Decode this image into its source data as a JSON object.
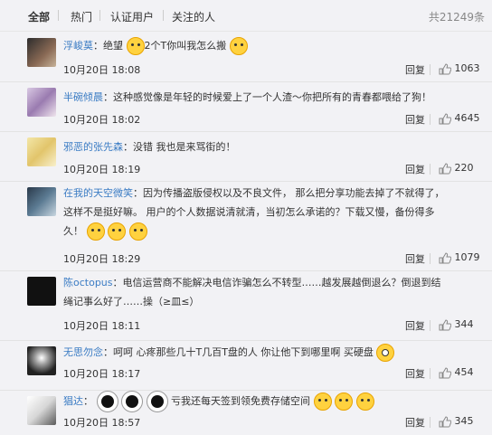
{
  "tabs": [
    {
      "label": "全部",
      "active": true
    },
    {
      "label": "热门",
      "active": false
    },
    {
      "label": "认证用户",
      "active": false
    },
    {
      "label": "关注的人",
      "active": false
    }
  ],
  "total_count": "共21249条",
  "reply_label": "回复",
  "comments": [
    {
      "user": "浮峻莫",
      "text_parts": [
        "绝望",
        "2个T你叫我怎么搬"
      ],
      "time": "10月20日 18:08",
      "likes": "1063"
    },
    {
      "user": "半碗倾晨",
      "text": "这种感觉像是年轻的时候爱上了一个人渣～你把所有的青春都喂给了狗！",
      "time": "10月20日 18:02",
      "likes": "4645"
    },
    {
      "user": "邪恶的张先森",
      "text": "没错 我也是来骂街的！",
      "time": "10月20日 18:19",
      "likes": "220"
    },
    {
      "user": "在我的天空微笑",
      "text_lines": [
        "因为传播盗版侵权以及不良文件， 那么把分享功能去掉了不就得了，",
        "这样不是挺好嘛。 用户的个人数据说清就清，当初怎么承诺的？下载又慢，备份得多",
        "久！"
      ],
      "time": "10月20日 18:29",
      "likes": "1079"
    },
    {
      "user": "陈octopus",
      "text_lines": [
        "电信运营商不能解决电信诈骗怎么不转型……越发展越倒退么？倒退到结",
        "绳记事么好了……操（≥皿≤）"
      ],
      "time": "10月20日 18:11",
      "likes": "344"
    },
    {
      "user": "无思勿念",
      "text": "呵呵 心疼那些几十T几百T盘的人 你让他下到哪里啊 买硬盘",
      "time": "10月20日 18:17",
      "likes": "454"
    },
    {
      "user": "猖达",
      "text": "亏我还每天签到领免费存储空间",
      "time": "10月20日 18:57",
      "likes": "345"
    }
  ]
}
